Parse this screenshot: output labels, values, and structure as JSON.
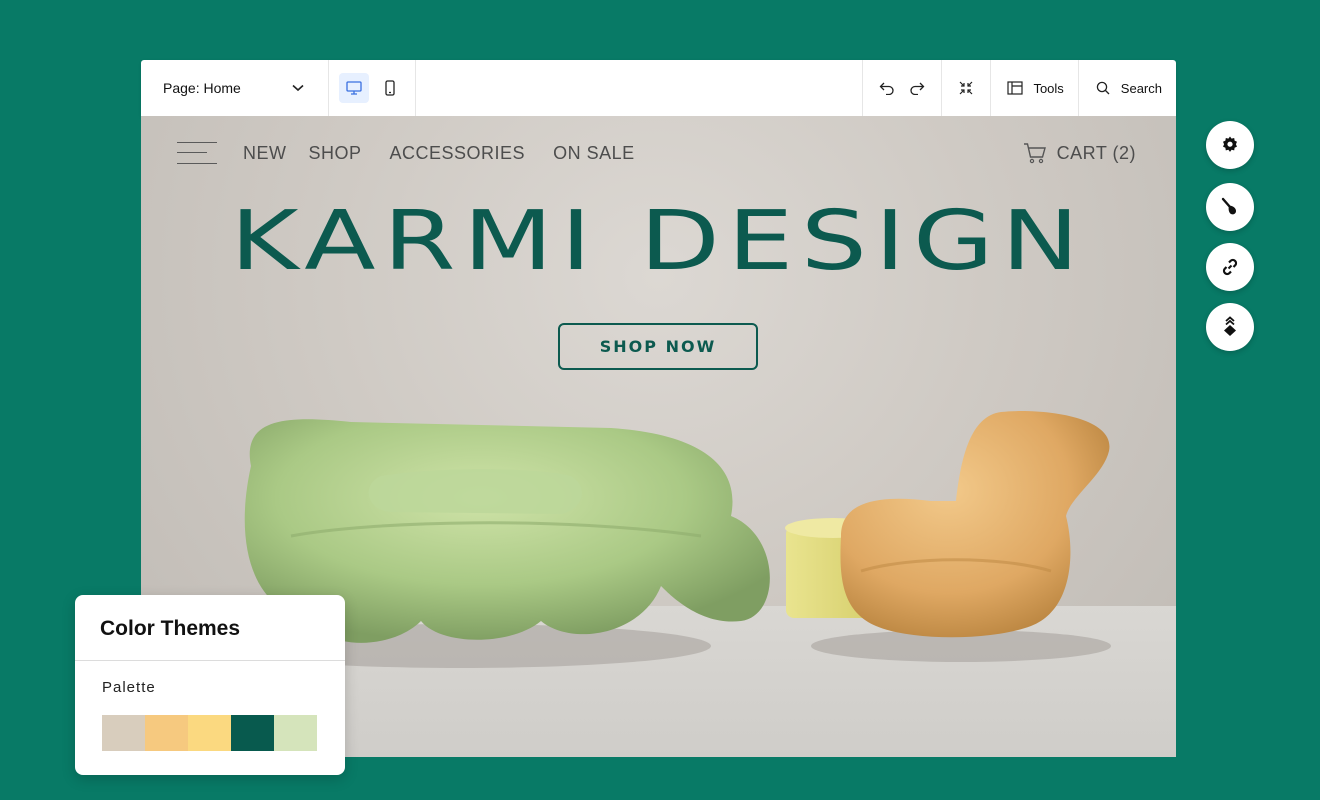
{
  "toolbar": {
    "page_label": "Page: Home",
    "tools_label": "Tools",
    "search_label": "Search",
    "active_device": "desktop"
  },
  "site": {
    "nav": [
      "NEW",
      "SHOP",
      "ACCESSORIES",
      "ON SALE"
    ],
    "cart_label": "CART (2)",
    "hero_title": "KARMI DESIGN",
    "cta_label": "SHOP NOW"
  },
  "side_tools": [
    "gear-icon",
    "paintbrush-icon",
    "link-icon",
    "layers-icon"
  ],
  "color_themes": {
    "title": "Color Themes",
    "palette_label": "Palette",
    "swatches": [
      "#d8cdbd",
      "#f6c97f",
      "#fbd980",
      "#085a4e",
      "#d5e4bb"
    ]
  },
  "colors": {
    "background": "#087a66",
    "brand_green": "#0c5a4f"
  }
}
